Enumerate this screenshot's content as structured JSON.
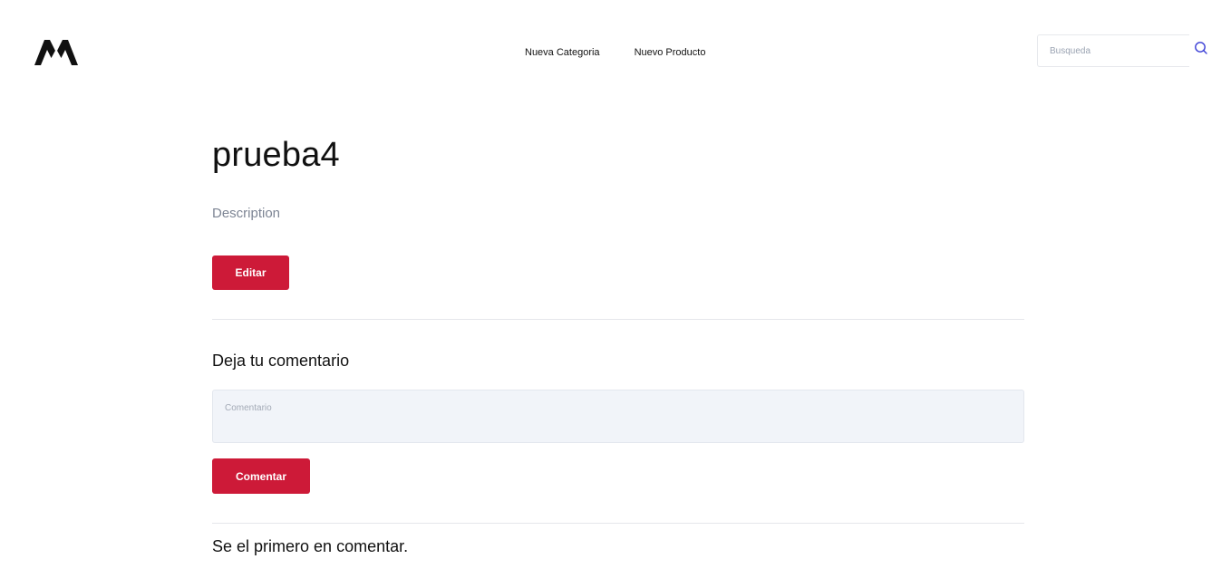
{
  "header": {
    "logo_icon": "mountain-logo-icon",
    "nav": [
      {
        "label": "Nueva Categoria"
      },
      {
        "label": "Nuevo Producto"
      }
    ],
    "search": {
      "placeholder": "Busqueda",
      "value": "",
      "icon": "search-icon"
    }
  },
  "product": {
    "title": "prueba4",
    "description": "Description",
    "edit_label": "Editar"
  },
  "comments": {
    "heading": "Deja tu comentario",
    "placeholder": "Comentario",
    "value": "",
    "submit_label": "Comentar",
    "empty_message": "Se el primero en comentar."
  },
  "colors": {
    "accent": "#cd1a38",
    "search_icon": "#3b3fd6",
    "muted_text": "#7d8594",
    "input_background": "#f1f4f9"
  }
}
